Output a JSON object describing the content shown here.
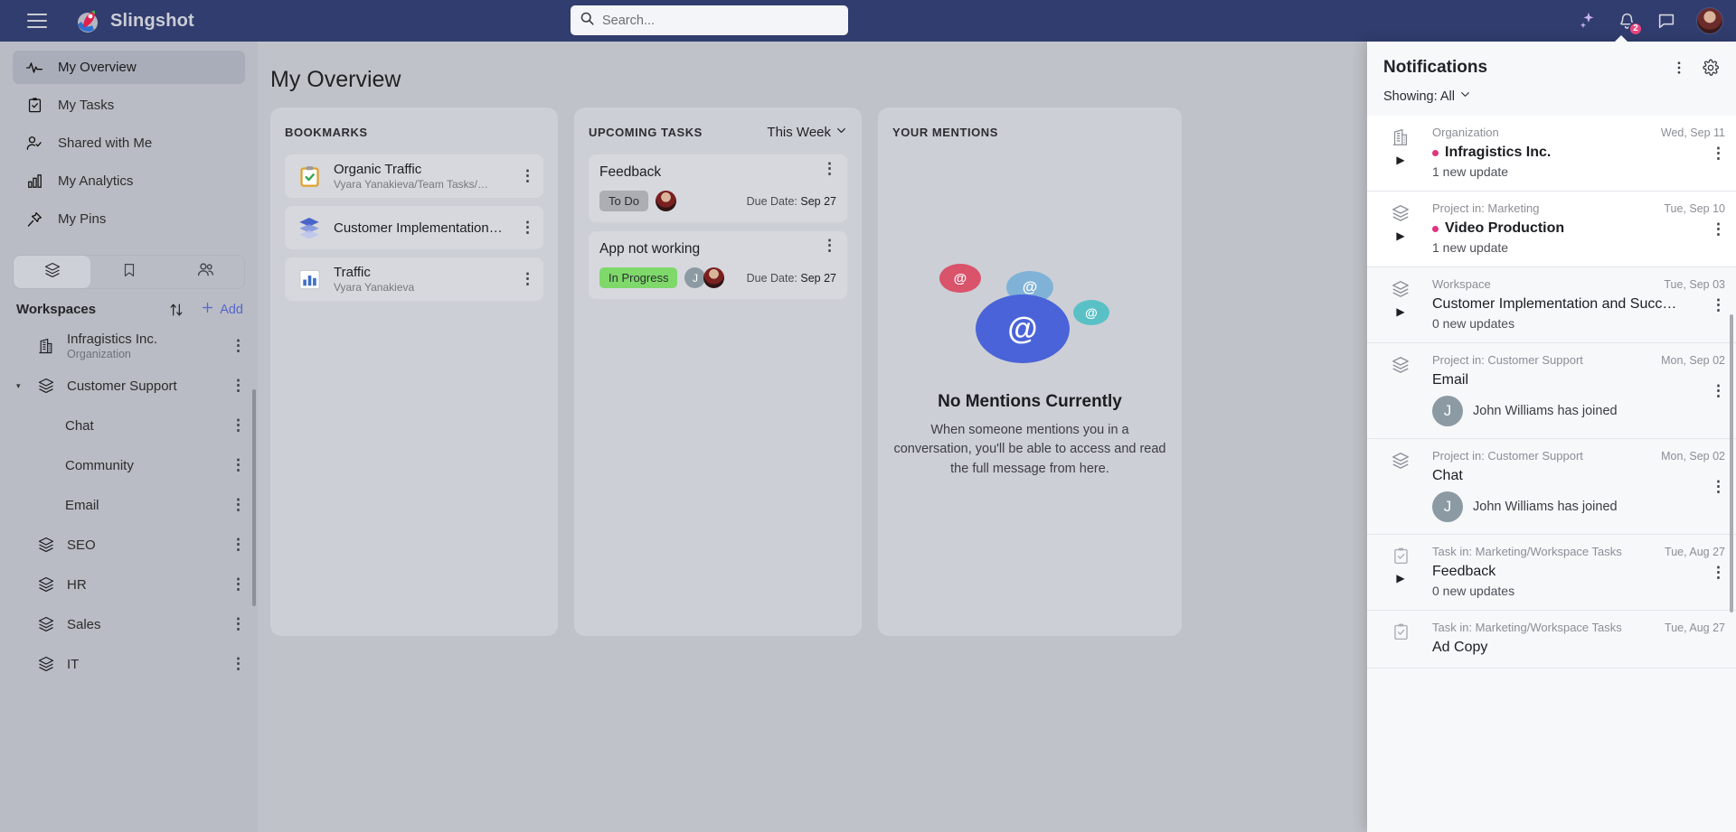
{
  "topbar": {
    "brand": "Slingshot",
    "menu_icon": "hamburger-icon",
    "search_placeholder": "Search...",
    "search_value": "",
    "ai_icon": "sparkle-icon",
    "bell_icon": "bell-icon",
    "notifications_count": "2",
    "chat_icon": "chat-icon",
    "avatar": "user-avatar"
  },
  "sidebar": {
    "nav": [
      {
        "label": "My Overview",
        "icon": "pulse-icon",
        "active": true
      },
      {
        "label": "My Tasks",
        "icon": "clipboard-check-icon",
        "active": false
      },
      {
        "label": "Shared with Me",
        "icon": "person-check-icon",
        "active": false
      },
      {
        "label": "My Analytics",
        "icon": "bar-chart-icon",
        "active": false
      },
      {
        "label": "My Pins",
        "icon": "pin-icon",
        "active": false
      }
    ],
    "tabs": [
      {
        "name": "workspaces-tab",
        "icon": "layers-icon",
        "active": true
      },
      {
        "name": "bookmarks-tab",
        "icon": "bookmark-icon",
        "active": false
      },
      {
        "name": "people-tab",
        "icon": "people-icon",
        "active": false
      }
    ],
    "workspaces_title": "Workspaces",
    "sort_icon": "sort-arrows-icon",
    "add_label": "Add",
    "add_icon": "plus-icon",
    "workspaces": [
      {
        "name": "Infragistics Inc.",
        "sub": "Organization",
        "icon": "building-icon",
        "child": false,
        "caret": ""
      },
      {
        "name": "Customer Support",
        "sub": "",
        "icon": "layers-icon",
        "child": false,
        "caret": "▾"
      },
      {
        "name": "Chat",
        "sub": "",
        "icon": "",
        "child": true,
        "caret": ""
      },
      {
        "name": "Community",
        "sub": "",
        "icon": "",
        "child": true,
        "caret": ""
      },
      {
        "name": "Email",
        "sub": "",
        "icon": "",
        "child": true,
        "caret": ""
      },
      {
        "name": "SEO",
        "sub": "",
        "icon": "layers-icon",
        "child": false,
        "caret": ""
      },
      {
        "name": "HR",
        "sub": "",
        "icon": "layers-icon",
        "child": false,
        "caret": ""
      },
      {
        "name": "Sales",
        "sub": "",
        "icon": "layers-icon",
        "child": false,
        "caret": ""
      },
      {
        "name": "IT",
        "sub": "",
        "icon": "layers-icon",
        "child": false,
        "caret": ""
      }
    ]
  },
  "main": {
    "page_title": "My Overview",
    "bookmarks": {
      "title": "BOOKMARKS",
      "items": [
        {
          "name": "Organic Traffic",
          "sub": "Vyara Yanakieva/Team Tasks/…",
          "icon": "clipboard-check-icon"
        },
        {
          "name": "Customer Implementation…",
          "sub": "",
          "icon": "layers-icon"
        },
        {
          "name": "Traffic",
          "sub": "Vyara Yanakieva",
          "icon": "bar-chart-icon"
        }
      ]
    },
    "upcoming": {
      "title": "UPCOMING TASKS",
      "filter": "This Week",
      "filter_icon": "chevron-down-icon",
      "due_label": "Due Date:",
      "items": [
        {
          "name": "Feedback",
          "status": "To Do",
          "status_kind": "todo",
          "due": "Sep 27",
          "avatars": [
            "red"
          ]
        },
        {
          "name": "App not working",
          "status": "In Progress",
          "status_kind": "progress",
          "due": "Sep 27",
          "avatars": [
            "J",
            "red"
          ]
        }
      ]
    },
    "mentions": {
      "title": "YOUR MENTIONS",
      "empty_title": "No Mentions Currently",
      "empty_text": "When someone mentions you in a conversation, you'll be able to access and read the full message from here.",
      "art_icon": "at-bubbles-illustration"
    }
  },
  "notifications": {
    "title": "Notifications",
    "more_icon": "more-vertical-icon",
    "settings_icon": "gear-icon",
    "filter_label": "Showing: All",
    "filter_icon": "chevron-down-icon",
    "items": [
      {
        "source": "Organization",
        "date": "Wed, Sep 11",
        "title": "Infragistics Inc.",
        "sub": "1 new update",
        "unread": true,
        "bold": true,
        "caret": true,
        "icon": "building-icon",
        "avatar": "",
        "joined": ""
      },
      {
        "source": "Project in: Marketing",
        "date": "Tue, Sep 10",
        "title": "Video Production",
        "sub": "1 new update",
        "unread": true,
        "bold": true,
        "caret": true,
        "icon": "layers-icon",
        "avatar": "",
        "joined": ""
      },
      {
        "source": "Workspace",
        "date": "Tue, Sep 03",
        "title": "Customer Implementation and Succ…",
        "sub": "0 new updates",
        "unread": false,
        "bold": false,
        "caret": true,
        "icon": "layers-icon",
        "avatar": "",
        "joined": ""
      },
      {
        "source": "Project in: Customer Support",
        "date": "Mon, Sep 02",
        "title": "Email",
        "sub": "",
        "unread": false,
        "bold": false,
        "caret": false,
        "icon": "layers-icon",
        "avatar": "J",
        "joined": "John Williams has joined"
      },
      {
        "source": "Project in: Customer Support",
        "date": "Mon, Sep 02",
        "title": "Chat",
        "sub": "",
        "unread": false,
        "bold": false,
        "caret": false,
        "icon": "layers-icon",
        "avatar": "J",
        "joined": "John Williams has joined"
      },
      {
        "source": "Task in: Marketing/Workspace Tasks",
        "date": "Tue, Aug 27",
        "title": "Feedback",
        "sub": "0 new updates",
        "unread": false,
        "bold": false,
        "caret": true,
        "icon": "clipboard-check-icon",
        "avatar": "",
        "joined": ""
      },
      {
        "source": "Task in: Marketing/Workspace Tasks",
        "date": "Tue, Aug 27",
        "title": "Ad Copy",
        "sub": "",
        "unread": false,
        "bold": false,
        "caret": false,
        "icon": "clipboard-check-icon",
        "avatar": "",
        "joined": ""
      }
    ]
  },
  "colors": {
    "topbar": "#313d6e",
    "accent_pink": "#e0357f",
    "accent_blue": "#5566cf",
    "status_progress": "#7ed96a",
    "panel_bg": "#f7f8fa"
  }
}
